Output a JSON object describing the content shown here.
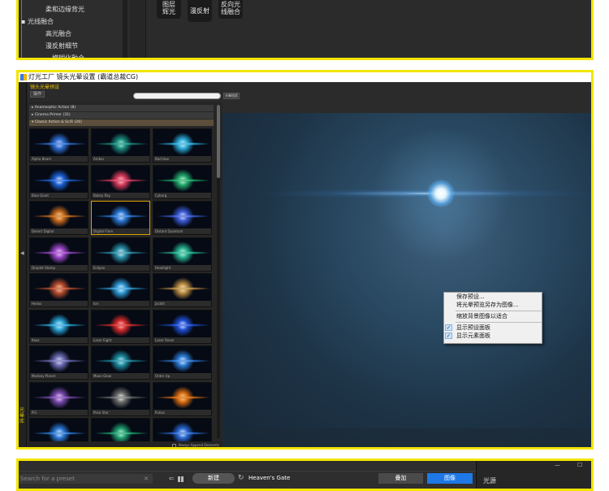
{
  "top_panel": {
    "tree": [
      "柔和边缘背光",
      "光线融合",
      "高光融合",
      "漫反射细节",
      "…模糊化融合"
    ],
    "tools": [
      {
        "label": "图层\n辉光"
      },
      {
        "label": "漫反射"
      },
      {
        "label": "反向光\n线融合"
      }
    ]
  },
  "mid_panel": {
    "title": "灯光工厂 镜头光晕设置 (霸道总裁CG)",
    "library_tag": "镜头光晕预设",
    "library_button": "操作",
    "search_button": "光晕搜索",
    "side_vertical_text": "光晕库",
    "categories": [
      "▸ Anamorphic Action (8)",
      "▸ Cinema Primer (31)",
      "▾ Classic Action & SciFi (26)"
    ],
    "thumbs": [
      {
        "label": "Alpha Beam",
        "c1": "#dfe9ff",
        "c2": "#2d6cd1"
      },
      {
        "label": "Ambar",
        "c1": "#bfffe8",
        "c2": "#1b8a7d"
      },
      {
        "label": "Bad Hue",
        "c1": "#e9fbff",
        "c2": "#2aa9d6"
      },
      {
        "label": "Blue Giant",
        "c1": "#ffffff",
        "c2": "#1c61d6"
      },
      {
        "label": "Bokey Ray",
        "c1": "#ffd9e0",
        "c2": "#d63a5a"
      },
      {
        "label": "Cyborg",
        "c1": "#e9ffe9",
        "c2": "#1fa86a"
      },
      {
        "label": "Desert Digital",
        "c1": "#ffe2b0",
        "c2": "#c66a1c"
      },
      {
        "label": "Digital Flare",
        "c1": "#ffffff",
        "c2": "#2a78d6"
      },
      {
        "label": "Distant Quantum",
        "c1": "#f2f6ff",
        "c2": "#3a5ad6"
      },
      {
        "label": "Droplet Stamp",
        "c1": "#ffe0ff",
        "c2": "#9a46c6"
      },
      {
        "label": "Eclipse",
        "c1": "#ffffff",
        "c2": "#2a90a8"
      },
      {
        "label": "Headlight",
        "c1": "#e6fff4",
        "c2": "#25b08e"
      },
      {
        "label": "Helios",
        "c1": "#ffe0c8",
        "c2": "#b84d2e"
      },
      {
        "label": "Ion",
        "c1": "#ffffff",
        "c2": "#2f9bd6"
      },
      {
        "label": "Jacklit",
        "c1": "#fff5d0",
        "c2": "#b88a40"
      },
      {
        "label": "Kaos",
        "c1": "#e9fbff",
        "c2": "#2aa3d6"
      },
      {
        "label": "Laser Eight",
        "c1": "#ffd6d6",
        "c2": "#d62a2a"
      },
      {
        "label": "Laser Rover",
        "c1": "#ffffff",
        "c2": "#1f4fd6"
      },
      {
        "label": "Monkey Planet",
        "c1": "#f0f0ff",
        "c2": "#6a6ab0"
      },
      {
        "label": "Moon Glow",
        "c1": "#e0ffff",
        "c2": "#1f8aa0"
      },
      {
        "label": "Order Up",
        "c1": "#ffffff",
        "c2": "#2b7ad6"
      },
      {
        "label": "Pi3",
        "c1": "#ffe6ff",
        "c2": "#7a4ab0"
      },
      {
        "label": "Pixie Star",
        "c1": "#ffffff",
        "c2": "#6a6a6a"
      },
      {
        "label": "Pulsar",
        "c1": "#ffe0a0",
        "c2": "#d66a10"
      },
      {
        "label": "",
        "c1": "#ffffff",
        "c2": "#2a78d6"
      },
      {
        "label": "",
        "c1": "#e0fff0",
        "c2": "#1fa070"
      },
      {
        "label": "",
        "c1": "#ffffff",
        "c2": "#2a6ad6"
      }
    ],
    "footer_label": "Always Append Elements",
    "context_menu": [
      {
        "label": "保存预设...",
        "checked": false
      },
      {
        "label": "将光晕预览另存为图像...",
        "checked": false
      },
      {
        "label": "缩放背景图像以适合",
        "checked": false,
        "sep_before": true
      },
      {
        "label": "显示预设面板",
        "checked": true,
        "sep_before": true
      },
      {
        "label": "显示元素面板",
        "checked": true
      }
    ]
  },
  "bottom_panel": {
    "search_placeholder": "Search for a preset",
    "clear": "✕",
    "back": "⇐",
    "new_button": "新建",
    "refresh": "↻",
    "preset_name": "Heaven's Gate",
    "add_button": "叠加",
    "image_button": "图像",
    "right_title": "光源",
    "minimize": "—",
    "maximize": "☐"
  },
  "colors": {
    "highlight_border": "#f2e500",
    "accent_blue": "#1e78e6"
  }
}
